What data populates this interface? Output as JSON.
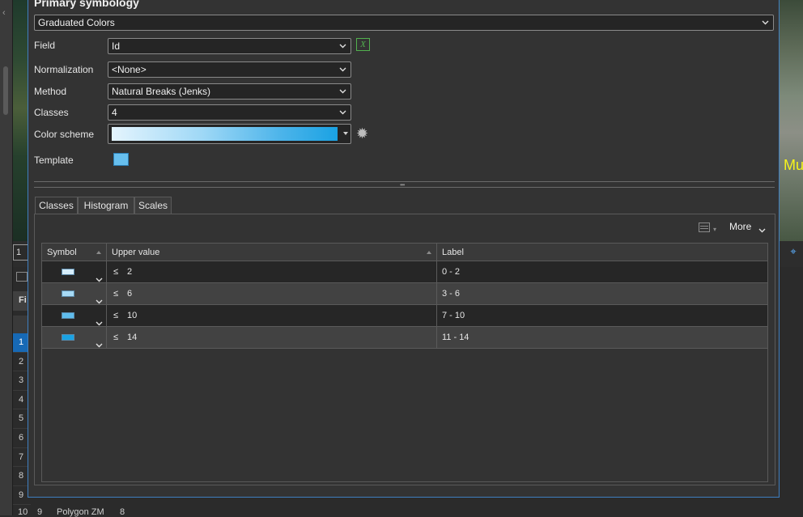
{
  "pane": {
    "title": "Primary symbology",
    "renderer": "Graduated Colors",
    "field": {
      "label": "Field",
      "value": "Id"
    },
    "normalization": {
      "label": "Normalization",
      "value": "<None>"
    },
    "method": {
      "label": "Method",
      "value": "Natural Breaks (Jenks)"
    },
    "classes": {
      "label": "Classes",
      "value": "4"
    },
    "color_scheme": {
      "label": "Color scheme",
      "start_color": "#e4f4fd",
      "end_color": "#1aa2e3"
    },
    "template": {
      "label": "Template",
      "color": "#67bfee"
    },
    "expression_icon_glyph": "X",
    "gear_glyph": "✹"
  },
  "tabs": [
    {
      "label": "Classes",
      "active": true
    },
    {
      "label": "Histogram",
      "active": false
    },
    {
      "label": "Scales",
      "active": false
    }
  ],
  "toolbar": {
    "more_label": "More"
  },
  "grid": {
    "columns": [
      "Symbol",
      "Upper value",
      "Label"
    ],
    "rows": [
      {
        "color": "#d7effc",
        "op": "≤",
        "upper": "2",
        "label": "0 - 2"
      },
      {
        "color": "#a7daf5",
        "op": "≤",
        "upper": "6",
        "label": "3 - 6"
      },
      {
        "color": "#5fbcec",
        "op": "≤",
        "upper": "10",
        "label": "7 - 10"
      },
      {
        "color": "#1aa2e3",
        "op": "≤",
        "upper": "14",
        "label": "11 - 14"
      }
    ]
  },
  "background": {
    "map_label": "Mu",
    "scale_box": "1",
    "table_header_text": "Fi",
    "row_numbers": [
      "1",
      "2",
      "3",
      "4",
      "5",
      "6",
      "7",
      "8",
      "9"
    ],
    "last_row": {
      "num": "10",
      "id": "9",
      "shape": "Polygon ZM",
      "val": "8"
    }
  }
}
